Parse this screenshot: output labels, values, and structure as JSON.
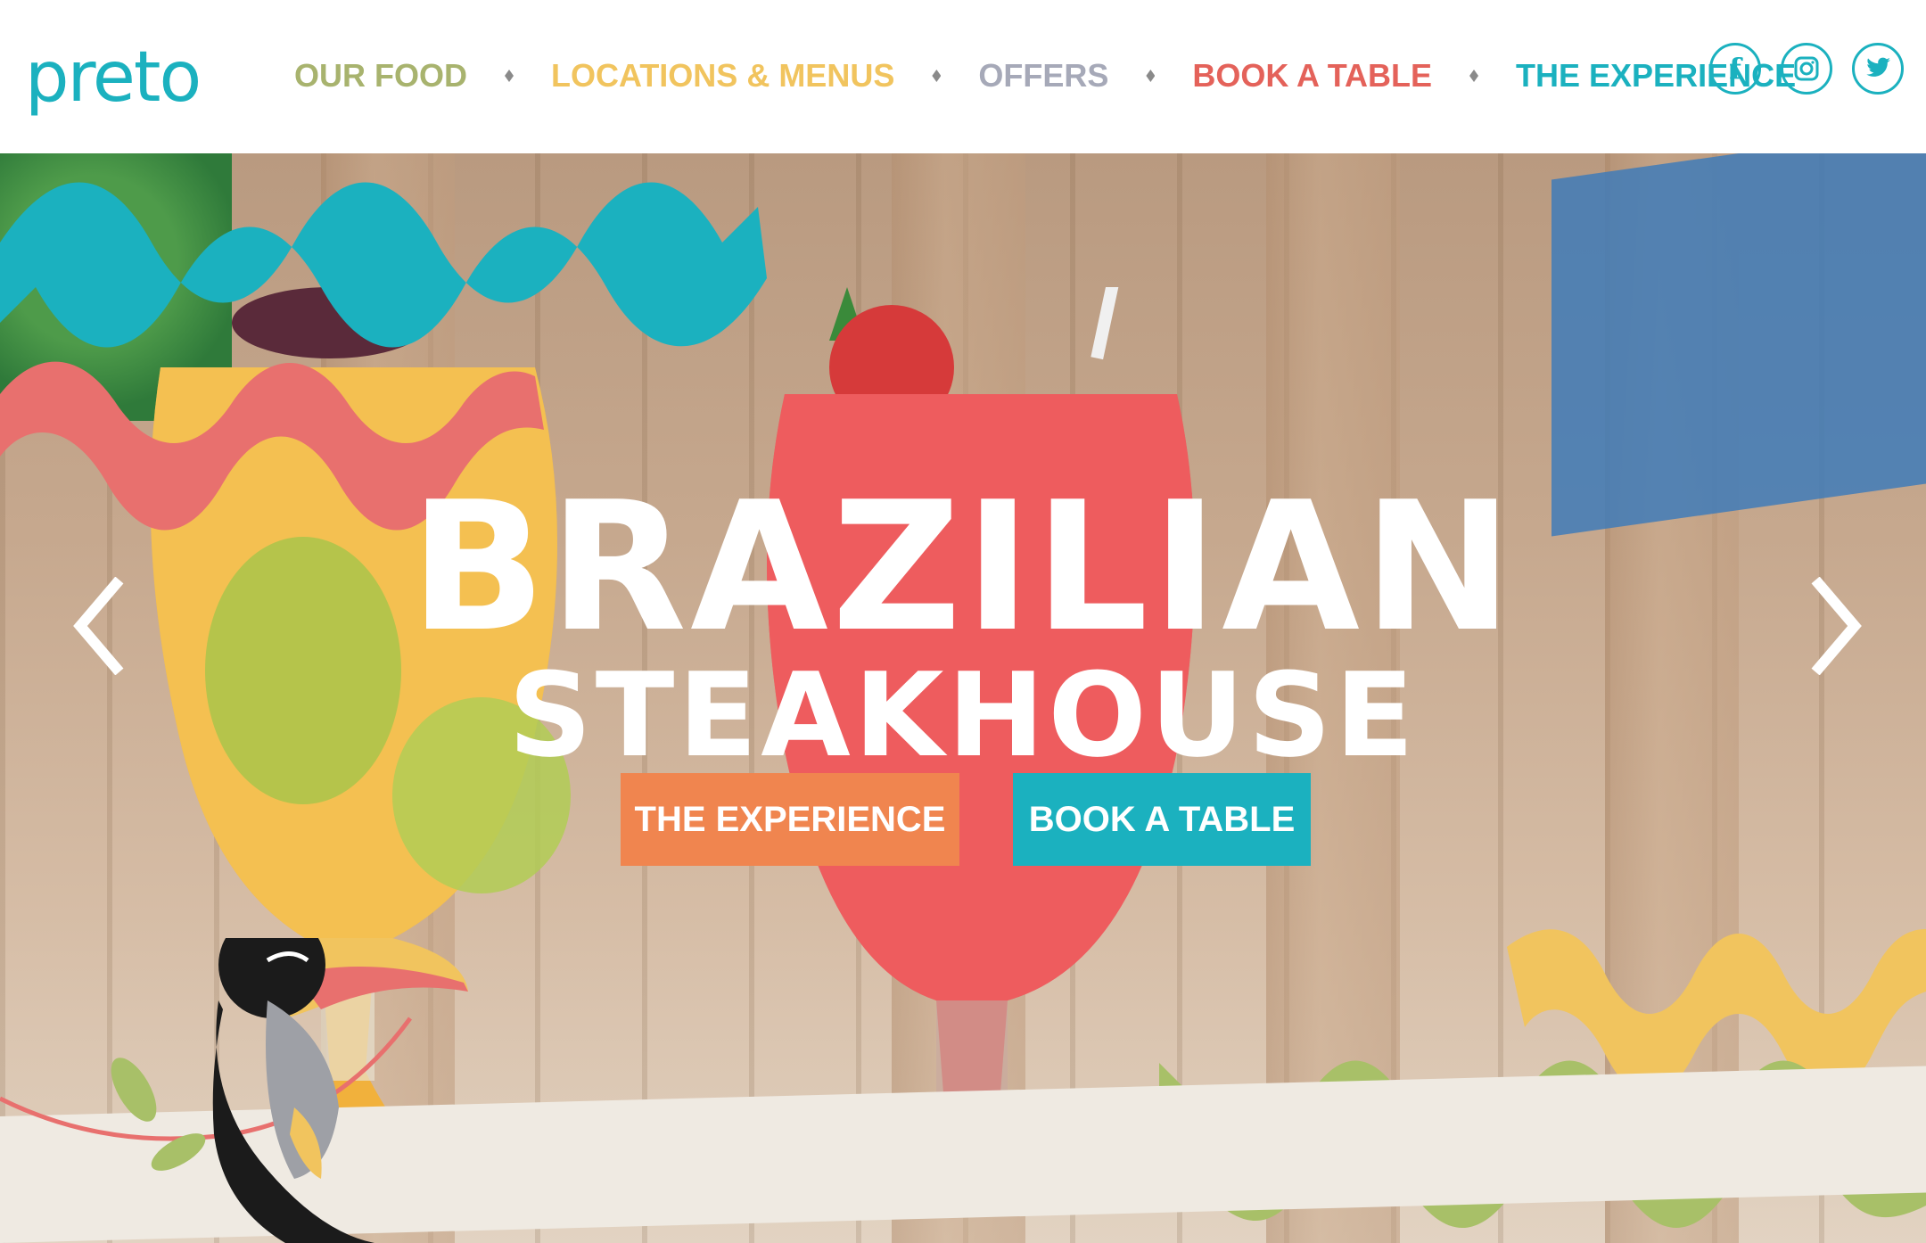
{
  "brand": {
    "logo_text": "preto"
  },
  "nav": {
    "items": [
      {
        "label": "OUR FOOD",
        "color": "#a8b36e"
      },
      {
        "label": "LOCATIONS & MENUS",
        "color": "#f1c45e"
      },
      {
        "label": "OFFERS",
        "color": "#a6a9b8"
      },
      {
        "label": "BOOK A TABLE",
        "color": "#e4625a"
      },
      {
        "label": "THE EXPERIENCE",
        "color": "#1bb1bf"
      }
    ]
  },
  "social": {
    "icons": [
      "facebook-icon",
      "instagram-icon",
      "twitter-icon"
    ],
    "facebook_glyph": "f"
  },
  "hero": {
    "title_line1": "BRAZILIAN",
    "title_line2": "STEAKHOUSE",
    "cta_primary": "THE EXPERIENCE",
    "cta_secondary": "BOOK A TABLE",
    "colors": {
      "teal": "#1bb1bf",
      "coral": "#e8706e",
      "orange": "#f0854f",
      "yellow": "#f1c45e",
      "green": "#a8c068"
    }
  }
}
